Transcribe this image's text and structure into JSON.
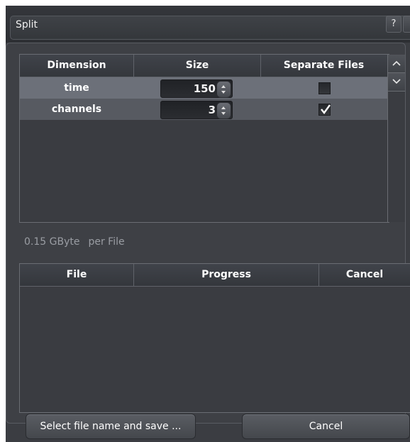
{
  "window": {
    "title": "Split",
    "help_label": "?"
  },
  "dimension_table": {
    "headers": [
      "Dimension",
      "Size",
      "Separate Files"
    ],
    "rows": [
      {
        "dimension": "time",
        "size": "150",
        "separate_files": false
      },
      {
        "dimension": "channels",
        "size": "3",
        "separate_files": true
      }
    ]
  },
  "size_info": {
    "value": "0.15 GByte",
    "unit": "per File"
  },
  "progress_table": {
    "headers": [
      "File",
      "Progress",
      "Cancel"
    ],
    "rows": []
  },
  "buttons": {
    "save_label": "Select file name and save ...",
    "cancel_label": "Cancel"
  },
  "icons": {
    "help": "question-icon",
    "scroll_up": "chevron-up-icon",
    "scroll_down": "chevron-down-icon",
    "spin": "spin-arrows-icon",
    "check": "checkmark-icon"
  },
  "colors": {
    "background": "#3b3d42",
    "selected_row": "#6c7079",
    "row": "#575a61",
    "muted_text": "#9a9da3"
  }
}
